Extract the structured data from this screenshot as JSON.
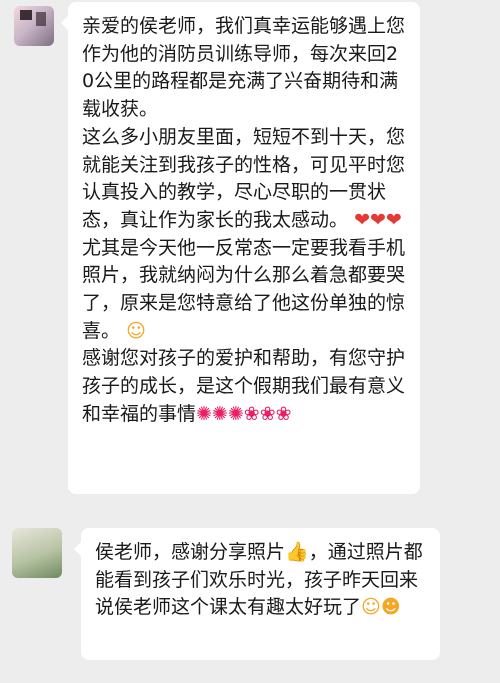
{
  "messages": [
    {
      "paragraphs": [
        {
          "text": "亲爱的侯老师，我们真幸运能够遇上您作为他的消防员训练导师，每次来回20公里的路程都是充满了兴奋期待和满载收获。",
          "emoji": ""
        },
        {
          "text": "这么多小朋友里面，短短不到十天，您就能关注到我孩子的性格，可见平时您认真投入的教学，尽心尽职的一贯状态，真让作为家长的我太感动。",
          "emoji": "❤❤❤"
        },
        {
          "text": "尤其是今天他一反常态一定要我看手机照片，我就纳闷为什么那么着急都要哭了，原来是您特意给了他这份单独的惊喜。",
          "emoji": "☺"
        },
        {
          "text": "感谢您对孩子的爱护和帮助，有您守护孩子的成长，是这个假期我们最有意义和幸福的事情",
          "emoji": "✺✺✺❀❀❀"
        }
      ]
    },
    {
      "paragraphs": [
        {
          "text": "侯老师，感谢分享照片",
          "emoji": "👍",
          "text2": "，通过照片都能看到孩子们欢乐时光，孩子昨天回来说侯老师这个课太有趣太好玩了",
          "emoji2": "☺☻"
        }
      ]
    }
  ],
  "colors": {
    "background": "#ededed",
    "bubble": "#ffffff",
    "text": "#1a1a1a"
  }
}
